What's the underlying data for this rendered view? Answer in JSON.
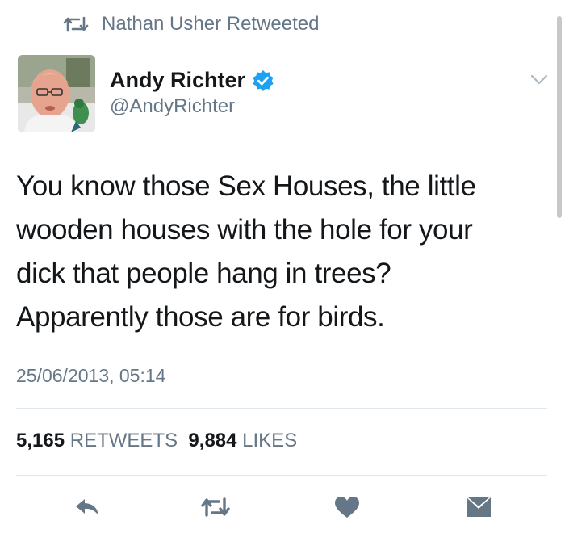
{
  "retweet_header": {
    "text": "Nathan Usher Retweeted",
    "icon": "retweet-icon"
  },
  "author": {
    "display_name": "Andy Richter",
    "handle": "@AndyRichter",
    "verified": true,
    "verified_icon": "verified-badge-icon",
    "avatar": "avatar"
  },
  "tweet": {
    "text_lines": [
      "You know those Sex Houses, the little",
      "wooden houses with the hole for your",
      "dick that people hang in trees?",
      "Apparently those are for birds."
    ],
    "timestamp": "25/06/2013, 05:14"
  },
  "stats": {
    "retweets_count": "5,165",
    "retweets_label": "RETWEETS",
    "likes_count": "9,884",
    "likes_label": "LIKES"
  },
  "actions": [
    "reply-icon",
    "retweet-icon",
    "like-icon",
    "message-icon"
  ],
  "colors": {
    "text": "#14171a",
    "secondary": "#657786",
    "verified": "#1da1f2",
    "divider": "#e1e8ed",
    "action_icon": "#657786"
  }
}
